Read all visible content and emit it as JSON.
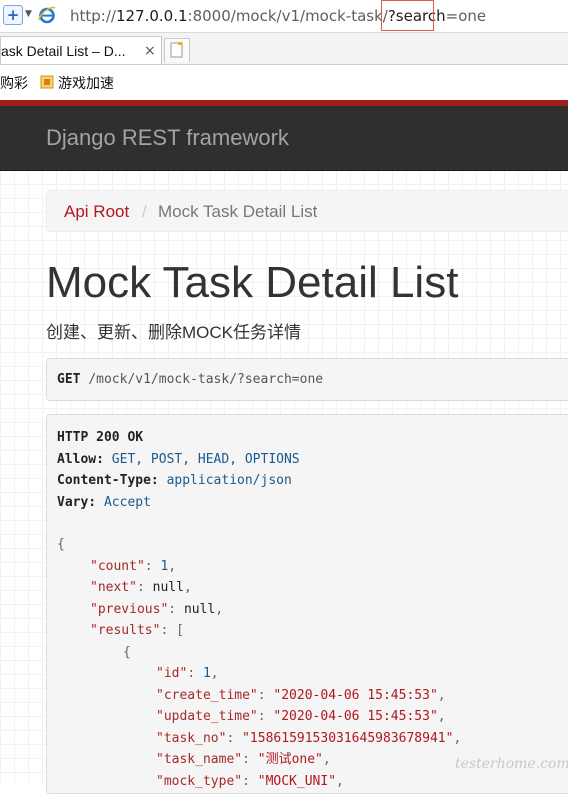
{
  "browser": {
    "url_prefix": "http://",
    "url_host": "127.0.0.1",
    "url_path": ":8000/mock/v1/mock-task/",
    "url_query_highlight": "?search",
    "url_query_rest": "=one",
    "tab_title": "ask Detail List – D...",
    "tab_close": "×",
    "favorites": [
      "购彩",
      "游戏加速"
    ]
  },
  "navbar": {
    "brand": "Django REST framework",
    "accent": "#a11e20"
  },
  "breadcrumb": {
    "root": "Api Root",
    "separator": "/",
    "current": "Mock Task Detail List"
  },
  "page": {
    "title": "Mock Task Detail List",
    "description": "创建、更新、删除MOCK任务详情"
  },
  "request": {
    "method": "GET",
    "path": "/mock/v1/mock-task/?search=one"
  },
  "response": {
    "status": "HTTP 200 OK",
    "headers": [
      {
        "name": "Allow:",
        "value": "GET, POST, HEAD, OPTIONS"
      },
      {
        "name": "Content-Type:",
        "value": "application/json"
      },
      {
        "name": "Vary:",
        "value": "Accept"
      }
    ],
    "body_lines": [
      {
        "indent": 0,
        "tokens": [
          {
            "t": "{",
            "c": "pun"
          }
        ]
      },
      {
        "indent": 1,
        "tokens": [
          {
            "t": "\"count\"",
            "c": "key"
          },
          {
            "t": ": ",
            "c": "pun"
          },
          {
            "t": "1",
            "c": "num"
          },
          {
            "t": ",",
            "c": "pun"
          }
        ]
      },
      {
        "indent": 1,
        "tokens": [
          {
            "t": "\"next\"",
            "c": "key"
          },
          {
            "t": ": ",
            "c": "pun"
          },
          {
            "t": "null",
            "c": "nul"
          },
          {
            "t": ",",
            "c": "pun"
          }
        ]
      },
      {
        "indent": 1,
        "tokens": [
          {
            "t": "\"previous\"",
            "c": "key"
          },
          {
            "t": ": ",
            "c": "pun"
          },
          {
            "t": "null",
            "c": "nul"
          },
          {
            "t": ",",
            "c": "pun"
          }
        ]
      },
      {
        "indent": 1,
        "tokens": [
          {
            "t": "\"results\"",
            "c": "key"
          },
          {
            "t": ": [",
            "c": "pun"
          }
        ]
      },
      {
        "indent": 2,
        "tokens": [
          {
            "t": "{",
            "c": "pun"
          }
        ]
      },
      {
        "indent": 3,
        "tokens": [
          {
            "t": "\"id\"",
            "c": "key"
          },
          {
            "t": ": ",
            "c": "pun"
          },
          {
            "t": "1",
            "c": "num"
          },
          {
            "t": ",",
            "c": "pun"
          }
        ]
      },
      {
        "indent": 3,
        "tokens": [
          {
            "t": "\"create_time\"",
            "c": "key"
          },
          {
            "t": ": ",
            "c": "pun"
          },
          {
            "t": "\"2020-04-06 15:45:53\"",
            "c": "str"
          },
          {
            "t": ",",
            "c": "pun"
          }
        ]
      },
      {
        "indent": 3,
        "tokens": [
          {
            "t": "\"update_time\"",
            "c": "key"
          },
          {
            "t": ": ",
            "c": "pun"
          },
          {
            "t": "\"2020-04-06 15:45:53\"",
            "c": "str"
          },
          {
            "t": ",",
            "c": "pun"
          }
        ]
      },
      {
        "indent": 3,
        "tokens": [
          {
            "t": "\"task_no\"",
            "c": "key"
          },
          {
            "t": ": ",
            "c": "pun"
          },
          {
            "t": "\"1586159153031645983678941\"",
            "c": "str"
          },
          {
            "t": ",",
            "c": "pun"
          }
        ]
      },
      {
        "indent": 3,
        "tokens": [
          {
            "t": "\"task_name\"",
            "c": "key"
          },
          {
            "t": ": ",
            "c": "pun"
          },
          {
            "t": "\"测试one\"",
            "c": "str"
          },
          {
            "t": ",",
            "c": "pun"
          }
        ]
      },
      {
        "indent": 3,
        "tokens": [
          {
            "t": "\"mock_type\"",
            "c": "key"
          },
          {
            "t": ": ",
            "c": "pun"
          },
          {
            "t": "\"MOCK_UNI\"",
            "c": "str"
          },
          {
            "t": ",",
            "c": "pun"
          }
        ]
      }
    ]
  },
  "watermark": "testerhome.com"
}
